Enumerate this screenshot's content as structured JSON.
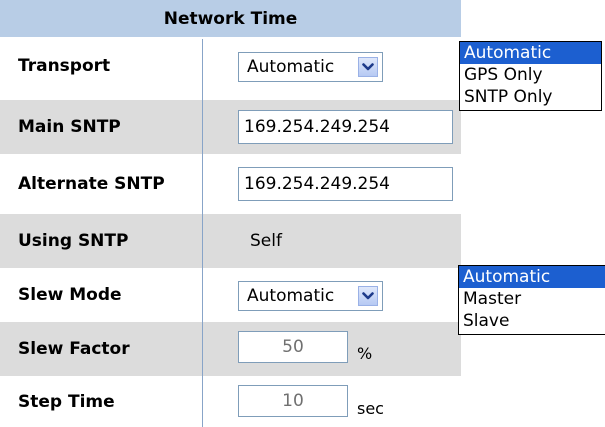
{
  "panel": {
    "title": "Network Time"
  },
  "rows": {
    "transport": {
      "label": "Transport",
      "value": "Automatic"
    },
    "main_sntp": {
      "label": "Main SNTP",
      "value": "169.254.249.254"
    },
    "alternate_sntp": {
      "label": "Alternate SNTP",
      "value": "169.254.249.254"
    },
    "using_sntp": {
      "label": "Using SNTP",
      "value": "Self"
    },
    "slew_mode": {
      "label": "Slew Mode",
      "value": "Automatic"
    },
    "slew_factor": {
      "label": "Slew Factor",
      "value": "50",
      "unit": "%"
    },
    "step_time": {
      "label": "Step Time",
      "value": "10",
      "unit": "sec"
    }
  },
  "transport_options": {
    "items": [
      "Automatic",
      "GPS Only",
      "SNTP Only"
    ],
    "selected": "Automatic"
  },
  "slew_mode_options": {
    "items": [
      "Automatic",
      "Master",
      "Slave"
    ],
    "selected": "Automatic"
  },
  "icons": {
    "dropdown": "chevron-down-icon"
  },
  "colors": {
    "title_bar": "#b8cde6",
    "row_shade": "#dcdcdc",
    "selected_option": "#1c5fd0"
  }
}
